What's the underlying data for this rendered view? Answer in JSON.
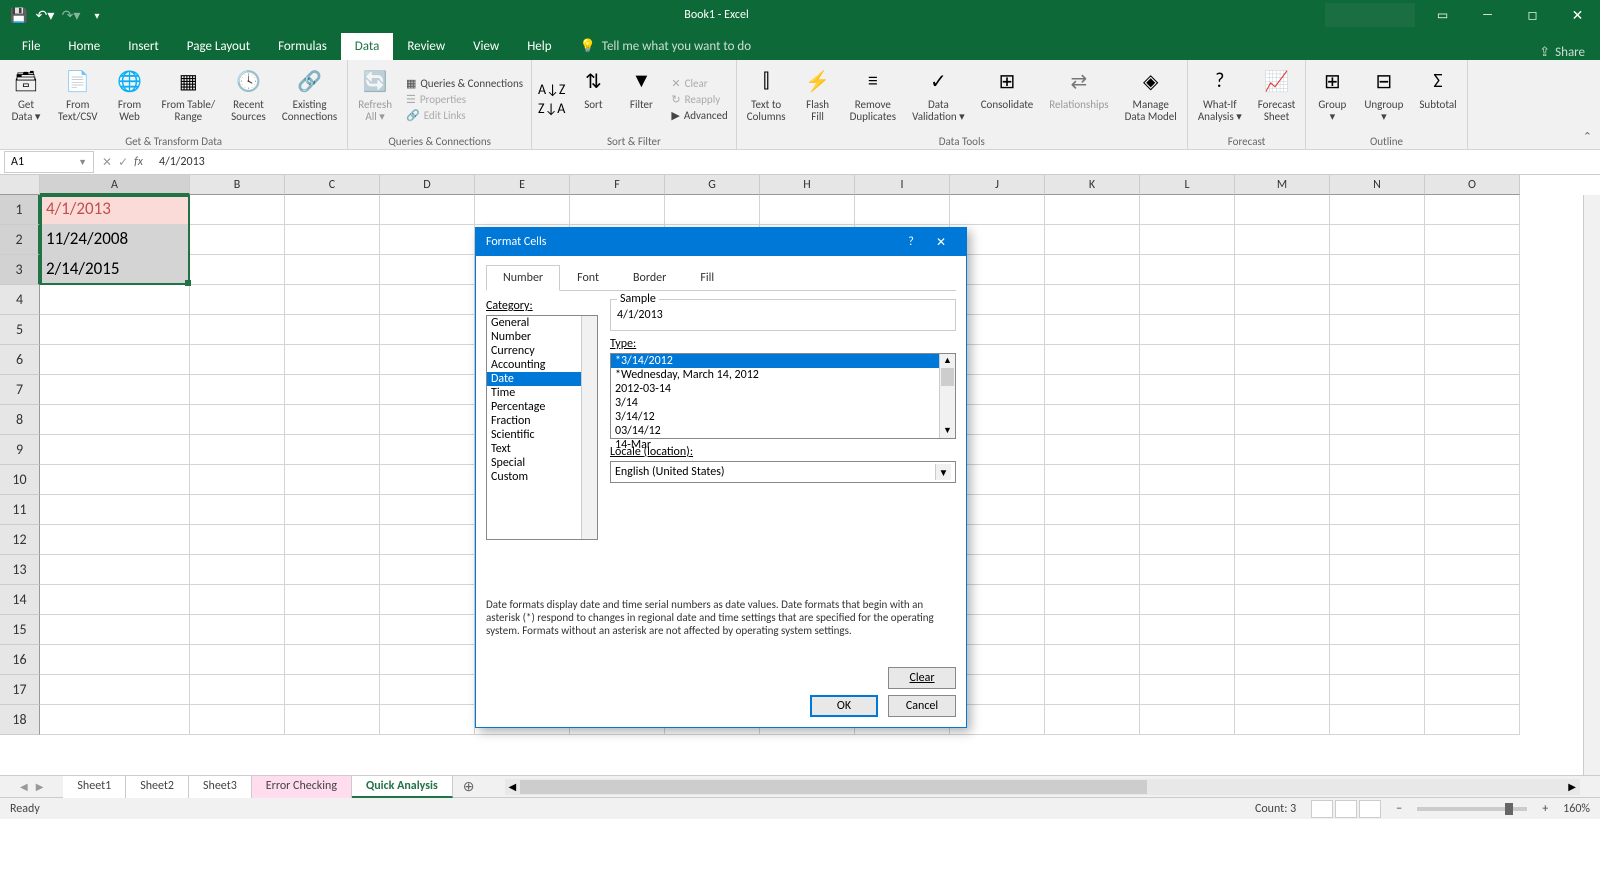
{
  "app": {
    "title": "Book1 - Excel"
  },
  "tabs": [
    "File",
    "Home",
    "Insert",
    "Page Layout",
    "Formulas",
    "Data",
    "Review",
    "View",
    "Help"
  ],
  "active_tab": "Data",
  "tell_me": "Tell me what you want to do",
  "share": "Share",
  "ribbon": {
    "get_data": "Get\nData ▾",
    "from_text": "From\nText/CSV",
    "from_web": "From\nWeb",
    "from_range": "From Table/\nRange",
    "recent": "Recent\nSources",
    "existing": "Existing\nConnections",
    "group1": "Get & Transform Data",
    "refresh": "Refresh\nAll ▾",
    "queries": "Queries & Connections",
    "properties": "Properties",
    "edit_links": "Edit Links",
    "group2": "Queries & Connections",
    "sort": "Sort",
    "filter": "Filter",
    "clear": "Clear",
    "reapply": "Reapply",
    "advanced": "Advanced",
    "group3": "Sort & Filter",
    "text_cols": "Text to\nColumns",
    "flash": "Flash\nFill",
    "dupes": "Remove\nDuplicates",
    "validation": "Data\nValidation ▾",
    "consolidate": "Consolidate",
    "relationships": "Relationships",
    "data_model": "Manage\nData Model",
    "group4": "Data Tools",
    "what_if": "What-If\nAnalysis ▾",
    "forecast": "Forecast\nSheet",
    "group5": "Forecast",
    "grp": "Group\n▾",
    "ungrp": "Ungroup\n▾",
    "subtotal": "Subtotal",
    "group6": "Outline"
  },
  "name_box": "A1",
  "formula": "4/1/2013",
  "columns": [
    "A",
    "B",
    "C",
    "D",
    "E",
    "F",
    "G",
    "H",
    "I",
    "J",
    "K",
    "L",
    "M",
    "N",
    "O"
  ],
  "rows": 18,
  "cells": {
    "A1": "4/1/2013",
    "A2": "11/24/2008",
    "A3": "2/14/2015"
  },
  "sheets": [
    "Sheet1",
    "Sheet2",
    "Sheet3",
    "Error Checking",
    "Quick Analysis"
  ],
  "active_sheet": "Quick Analysis",
  "status": {
    "ready": "Ready",
    "count": "Count: 3",
    "zoom": "160%"
  },
  "dialog": {
    "title": "Format Cells",
    "tabs": [
      "Number",
      "Font",
      "Border",
      "Fill"
    ],
    "active_tab": "Number",
    "category_label": "Category:",
    "categories": [
      "General",
      "Number",
      "Currency",
      "Accounting",
      "Date",
      "Time",
      "Percentage",
      "Fraction",
      "Scientific",
      "Text",
      "Special",
      "Custom"
    ],
    "selected_category": "Date",
    "sample_label": "Sample",
    "sample_value": "4/1/2013",
    "type_label": "Type:",
    "types": [
      "*3/14/2012",
      "*Wednesday, March 14, 2012",
      "2012-03-14",
      "3/14",
      "3/14/12",
      "03/14/12",
      "14-Mar"
    ],
    "selected_type": "*3/14/2012",
    "locale_label": "Locale (location):",
    "locale_value": "English (United States)",
    "description": "Date formats display date and time serial numbers as date values.  Date formats that begin with an asterisk (*) respond to changes in regional date and time settings that are specified for the operating system. Formats without an asterisk are not affected by operating system settings.",
    "clear": "Clear",
    "ok": "OK",
    "cancel": "Cancel"
  }
}
